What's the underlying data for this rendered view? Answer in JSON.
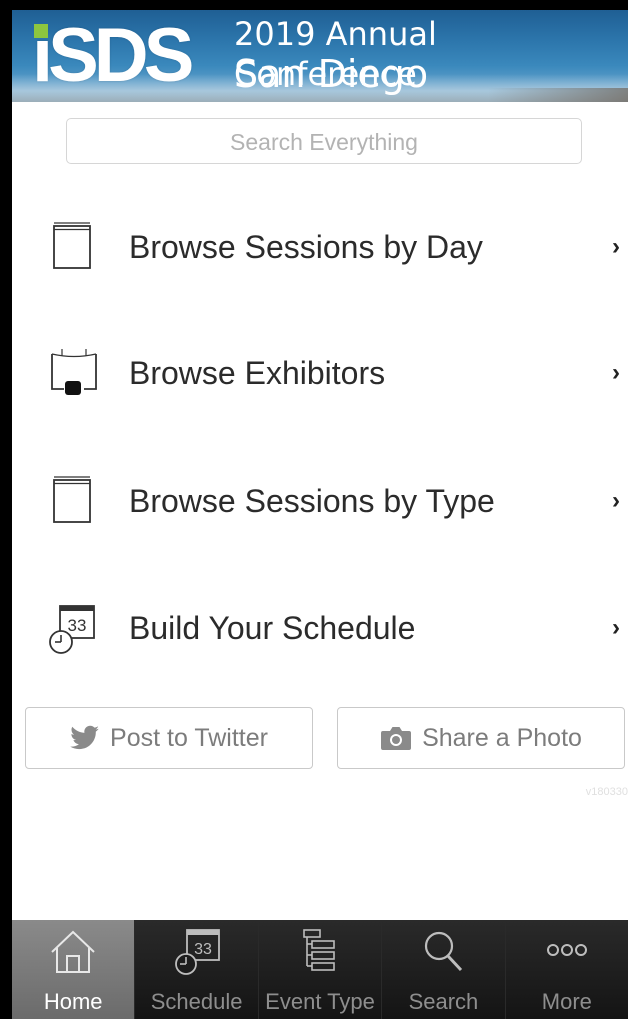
{
  "banner": {
    "logo_text": "iSDS",
    "line1": "2019 Annual Conference",
    "line2": "San Diego"
  },
  "search": {
    "placeholder": "Search Everything"
  },
  "menu": {
    "items": [
      {
        "label": "Browse Sessions by Day",
        "icon": "book-icon",
        "chevron": "›"
      },
      {
        "label": "Browse Exhibitors",
        "icon": "exhibitor-booth-icon",
        "chevron": "›"
      },
      {
        "label": "Browse Sessions by Type",
        "icon": "book-icon",
        "chevron": "›"
      },
      {
        "label": "Build Your Schedule",
        "icon": "calendar-clock-icon",
        "chevron": "›",
        "calendar_day": "33"
      }
    ]
  },
  "actions": {
    "twitter_label": "Post to Twitter",
    "photo_label": "Share a Photo"
  },
  "version": "v180330",
  "tabbar": {
    "active": "Home",
    "tabs": [
      {
        "label": "Home",
        "icon": "home-icon"
      },
      {
        "label": "Schedule",
        "icon": "calendar-clock-icon"
      },
      {
        "label": "Event Type",
        "icon": "tree-list-icon"
      },
      {
        "label": "Search",
        "icon": "search-icon"
      },
      {
        "label": "More",
        "icon": "more-dots-icon"
      }
    ]
  },
  "colors": {
    "tab_active_bg": "#777777",
    "tab_bg": "#141414",
    "logo_accent": "#8dc63f"
  }
}
